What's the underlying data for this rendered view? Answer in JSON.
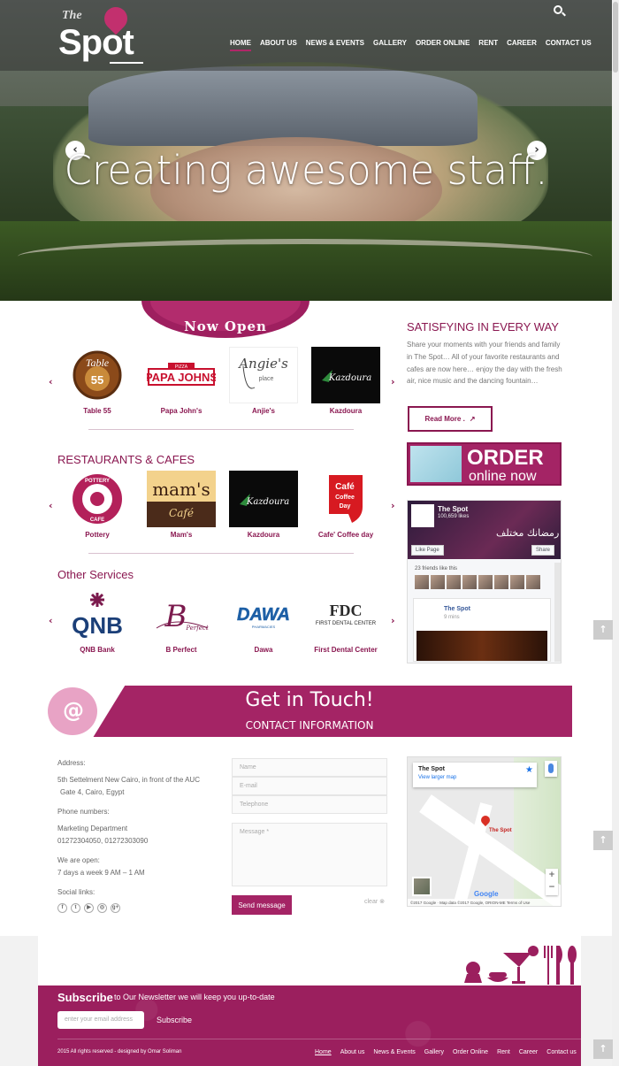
{
  "nav": {
    "items": [
      "HOME",
      "ABOUT US",
      "NEWS & EVENTS",
      "GALLERY",
      "ORDER ONLINE",
      "RENT",
      "CAREER",
      "CONTACT US"
    ]
  },
  "logo": {
    "the": "The",
    "spot": "Spot"
  },
  "hero": {
    "title": "Creating awesome staff."
  },
  "now_open": {
    "banner": "Now Open",
    "items": [
      "Table 55",
      "Papa John's",
      "Anjie's",
      "Kazdoura"
    ]
  },
  "restaurants": {
    "title": "RESTAURANTS & CAFES",
    "items": [
      "Pottery",
      "Mam's",
      "Kazdoura",
      "Cafe' Coffee day"
    ]
  },
  "services": {
    "title": "Other Services",
    "items": [
      "QNB Bank",
      "B Perfect",
      "Dawa",
      "First Dental Center"
    ]
  },
  "sidebar": {
    "title": "SATISFYING IN EVERY WAY",
    "text": "Share your moments with your friends and family in The Spot… All of your favorite restaurants and cafes are now here… enjoy the day with the fresh air, nice music and the dancing fountain…",
    "read_more": "Read More .",
    "order_t1": "ORDER",
    "order_t2": "online now"
  },
  "facebook": {
    "name": "The Spot",
    "likes": "100,659 likes",
    "arabic": "رمضانك مختلف",
    "like_page": "Like Page",
    "share": "Share",
    "friends": "23 friends like this",
    "post_name": "The Spot",
    "post_time": "9 mins"
  },
  "contact": {
    "title": "Get in Touch!",
    "subtitle": "CONTACT INFORMATION",
    "address_label": "Address:",
    "address_1": "5th Settelment New Cairo, in front of the AUC",
    "address_2": "Gate 4, Cairo, Egypt",
    "phones_label": "Phone numbers:",
    "dept": "Marketing Department",
    "phones": "01272304050, 01272303090",
    "open_label": "We are open:",
    "hours": "7 days a week 9 AM – 1 AM",
    "social_label": "Social links:",
    "social": [
      "f",
      "t",
      "▶",
      "◎",
      "g+"
    ],
    "name_ph": "Name",
    "email_ph": "E-mail",
    "phone_ph": "Telephone",
    "message_ph": "Message *",
    "send": "Send message",
    "clear": "clear"
  },
  "map": {
    "place": "The Spot",
    "link": "View larger map",
    "pin_label": "The Spot",
    "footer": "©2017 Google · Map data ©2017 Google, ORION-ME   Terms of Use",
    "google": "Google"
  },
  "subscribe": {
    "title": "Subscribe",
    "desc": "to Our Newsletter we will keep you up-to-date",
    "placeholder": "enter your email address",
    "button": "Subscribe"
  },
  "footer": {
    "copyright": "2015 All rights reserved - designed by Omar Soliman",
    "links": [
      "Home",
      "About us",
      "News & Events",
      "Gallery",
      "Order Online",
      "Rent",
      "Career",
      "Contact us"
    ]
  },
  "colors": {
    "brand": "#a42465",
    "brand_dark": "#8a1750"
  }
}
